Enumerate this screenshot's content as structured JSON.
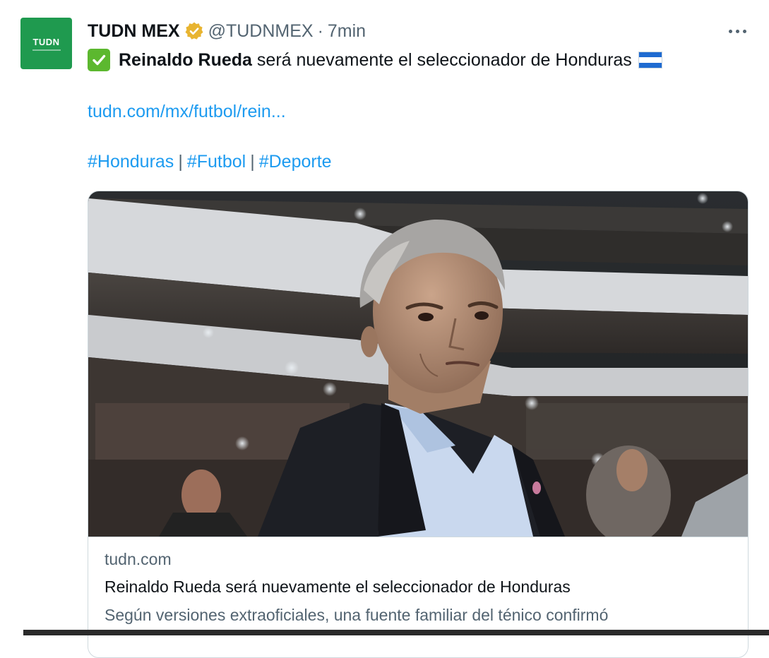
{
  "tweet": {
    "avatar_label": "TUDN",
    "author_name": "TUDN MEX",
    "verified_icon": "verified-badge-gold",
    "handle": "@TUDNMEX",
    "separator": "·",
    "time": "7min",
    "more_icon": "more-options-icon",
    "check_icon": "white-check-mark-emoji",
    "bold_text": "Reinaldo Rueda",
    "headline_text": "será nuevamente el seleccionador de Honduras",
    "flag_icon": "honduras-flag-emoji",
    "link_text": "tudn.com/mx/futbol/rein...",
    "hashtags": [
      "#Honduras",
      "#Futbol",
      "#Deporte"
    ],
    "hashtag_separator": "|",
    "card": {
      "domain": "tudn.com",
      "title": "Reinaldo Rueda será nuevamente el seleccionador de Honduras",
      "description": "Según versiones extraoficiales, una fuente familiar del ténico confirmó"
    }
  },
  "colors": {
    "avatar_bg": "#1f9a4f",
    "link": "#1d9bf0",
    "muted": "#536471",
    "text": "#0f1419",
    "verified": "#e8b430",
    "check": "#5cb82f",
    "border": "#cfd9de"
  }
}
